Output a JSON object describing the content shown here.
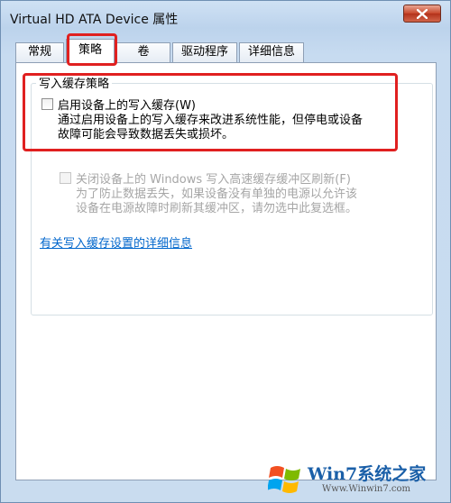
{
  "window": {
    "title": "Virtual HD ATA Device 属性"
  },
  "tabs": [
    {
      "label": "常规"
    },
    {
      "label": "策略"
    },
    {
      "label": "卷"
    },
    {
      "label": "驱动程序"
    },
    {
      "label": "详细信息"
    }
  ],
  "active_tab": "策略",
  "write_cache": {
    "group_title": "写入缓存策略",
    "enable_label": "启用设备上的写入缓存(W)",
    "enable_checked": false,
    "enable_desc_line1": "通过启用设备上的写入缓存来改进系统性能，但停电或设备",
    "enable_desc_line2": "故障可能会导致数据丢失或损坏。",
    "flush_label": "关闭设备上的 Windows 写入高速缓存缓冲区刷新(F)",
    "flush_checked": false,
    "flush_desc_line1": "为了防止数据丢失，如果设备没有单独的电源以允许该",
    "flush_desc_line2": "设备在电源故障时刷新其缓冲区，请勿选中此复选框。",
    "link_text": "有关写入缓存设置的详细信息"
  },
  "watermark": {
    "brand": "Win7系统之家",
    "url": "Www.Winwin7.com"
  },
  "colors": {
    "annotation": "#e02020",
    "link": "#0066cc",
    "close": "#c7462a"
  }
}
